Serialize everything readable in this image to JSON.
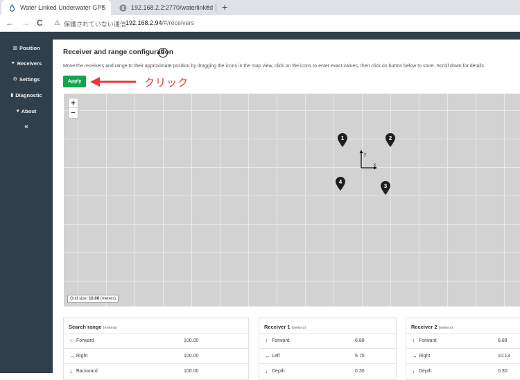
{
  "browser": {
    "tabs": [
      {
        "title": "Water Linked Underwater GPS",
        "close": "×",
        "active": true
      },
      {
        "title": "192.168.2.2:2770/waterlinked",
        "close": "×",
        "active": false
      }
    ],
    "new_tab": "+",
    "nav": {
      "back": "←",
      "forward": "→",
      "reload": "C"
    },
    "security_icon": "⚠",
    "security_text": "保護されていない通信",
    "url_host": "192.168.2.94",
    "url_path": "/#/receivers"
  },
  "sidebar": {
    "items": [
      {
        "icon": "▥",
        "label": "Position"
      },
      {
        "icon": "✦",
        "label": "Receivers"
      },
      {
        "icon": "⚙",
        "label": "Settings"
      },
      {
        "icon": "▮",
        "label": "Diagnostic"
      },
      {
        "icon": "♥",
        "label": "About"
      }
    ],
    "collapse": "«"
  },
  "main": {
    "title": "Receiver and range configuration",
    "help": "?",
    "description": "Move the receivers and range to their approximate position by dragging the icons in the map view, click on the icons to enter exact values, then click on button below to store. Scroll down for details.",
    "apply_label": "Apply",
    "annotation": "クリック"
  },
  "map": {
    "zoom_in": "+",
    "zoom_out": "−",
    "axis_x": "x",
    "axis_y": "y",
    "markers": [
      "1",
      "2",
      "3",
      "4"
    ],
    "grid_label": "Grid size:",
    "grid_value": "10.00",
    "grid_unit": "(meters)"
  },
  "tables": [
    {
      "title": "Search range",
      "unit": "(meters)",
      "rows": [
        {
          "icon": "↑",
          "label": "Forward",
          "value": "100.00"
        },
        {
          "icon": "→",
          "label": "Right",
          "value": "100.00"
        },
        {
          "icon": "↓",
          "label": "Backward",
          "value": "100.00"
        }
      ]
    },
    {
      "title": "Receiver 1",
      "unit": "(meters)",
      "rows": [
        {
          "icon": "↑",
          "label": "Forward",
          "value": "6.88"
        },
        {
          "icon": "←",
          "label": "Left",
          "value": "6.75"
        },
        {
          "icon": "↓",
          "label": "Depth",
          "value": "0.30"
        }
      ]
    },
    {
      "title": "Receiver 2",
      "unit": "(meters)",
      "rows": [
        {
          "icon": "↑",
          "label": "Forward",
          "value": "6.88"
        },
        {
          "icon": "→",
          "label": "Right",
          "value": "10.13"
        },
        {
          "icon": "↓",
          "label": "Depth",
          "value": "0.30"
        }
      ]
    }
  ]
}
